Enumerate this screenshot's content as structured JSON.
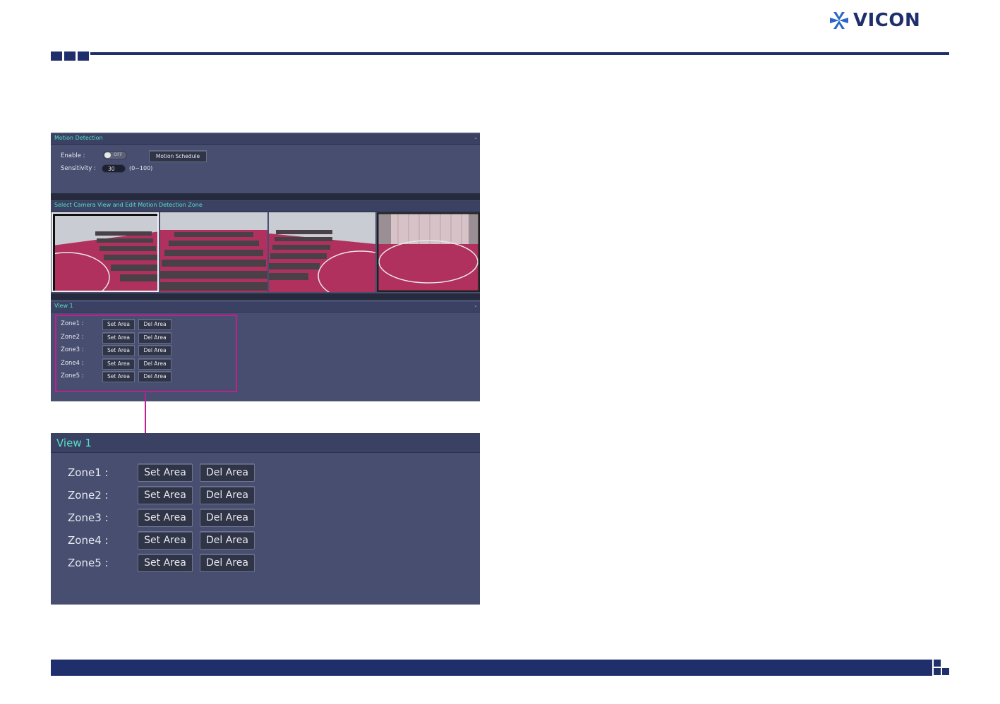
{
  "brand": {
    "name": "VICON",
    "color": "#1e2f6b",
    "icon": "vicon-star-icon"
  },
  "motion_panel": {
    "header": "Motion Detection",
    "enable_label": "Enable :",
    "toggle_state": "OFF",
    "schedule_button": "Motion Schedule",
    "sensitivity_label": "Sensitivity :",
    "sensitivity_value": "30",
    "sensitivity_range": "(0~100)"
  },
  "camera_section": {
    "header": "Select Camera View and Edit Motion Detection Zone",
    "views": [
      {
        "name": "camera-view-1",
        "selected": true
      },
      {
        "name": "camera-view-2",
        "selected": false
      },
      {
        "name": "camera-view-3",
        "selected": false
      },
      {
        "name": "camera-view-4",
        "selected": false
      }
    ]
  },
  "view_section": {
    "header": "View 1",
    "set_label": "Set Area",
    "del_label": "Del Area",
    "zones": [
      "Zone1 :",
      "Zone2 :",
      "Zone3 :",
      "Zone4 :",
      "Zone5 :"
    ]
  },
  "enlarged": {
    "header": "View 1",
    "set_label": "Set Area",
    "del_label": "Del Area",
    "zones": [
      "Zone1 :",
      "Zone2 :",
      "Zone3 :",
      "Zone4 :",
      "Zone5 :"
    ]
  },
  "colors": {
    "accent_magenta": "#c0208f",
    "header_text": "#58e0c8",
    "panel_bg": "#474e6f",
    "carpet": "#b0305e"
  }
}
